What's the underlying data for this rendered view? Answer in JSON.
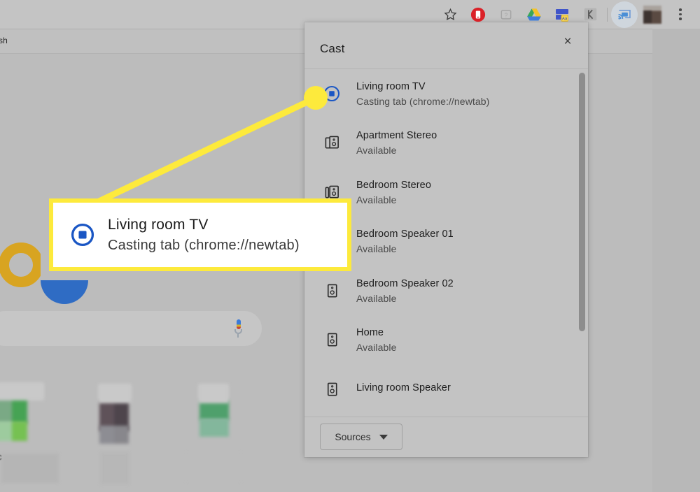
{
  "browser": {
    "toolbar_icons": [
      {
        "name": "bookmark-star-icon",
        "label": "Bookmark this tab"
      },
      {
        "name": "pocket-extension-icon",
        "label": "Pocket"
      },
      {
        "name": "disabled-extension-icon",
        "label": "Extension"
      },
      {
        "name": "google-drive-icon",
        "label": "Save to Google Drive"
      },
      {
        "name": "purple-extension-icon",
        "label": "Extension"
      },
      {
        "name": "gray-extension-icon",
        "label": "Extension"
      },
      {
        "name": "cast-icon",
        "label": "Cast"
      },
      {
        "name": "profile-avatar",
        "label": "Profile"
      },
      {
        "name": "chrome-menu-icon",
        "label": "Customize and control Google Chrome"
      }
    ],
    "bookmark_bar_text": "sh",
    "accent_cast_active": "#cfd6dd"
  },
  "page": {
    "search_placeholder": "",
    "search_value": "",
    "shortcut_label_partial": "c"
  },
  "cast": {
    "title": "Cast",
    "close_label": "×",
    "sources_button": "Sources",
    "devices": [
      {
        "name": "Living room TV",
        "status": "Casting tab (chrome://newtab)",
        "icon": "cast-active-icon",
        "selected": true
      },
      {
        "name": "Apartment Stereo",
        "status": "Available",
        "icon": "speaker-group-icon",
        "selected": false
      },
      {
        "name": "Bedroom Stereo",
        "status": "Available",
        "icon": "speaker-group-icon",
        "selected": false
      },
      {
        "name": "Bedroom Speaker 01",
        "status": "Available",
        "icon": "speaker-icon",
        "selected": false
      },
      {
        "name": "Bedroom Speaker 02",
        "status": "Available",
        "icon": "speaker-icon",
        "selected": false
      },
      {
        "name": "Home",
        "status": "Available",
        "icon": "speaker-icon",
        "selected": false
      },
      {
        "name": "Living room Speaker",
        "status": "",
        "icon": "speaker-icon",
        "selected": false
      }
    ]
  },
  "annotation": {
    "device_name": "Living room TV",
    "device_status": "Casting tab (chrome://newtab)",
    "highlight_color": "#fdea3c"
  }
}
